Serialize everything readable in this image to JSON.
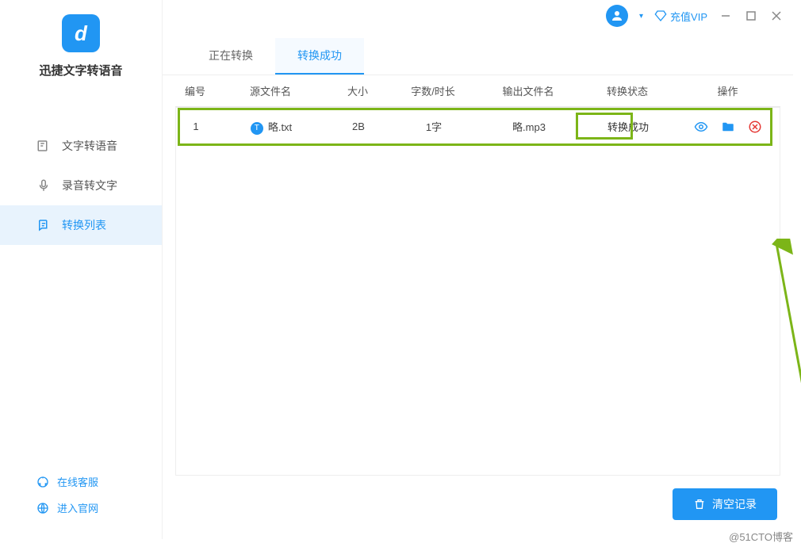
{
  "app": {
    "title": "迅捷文字转语音"
  },
  "sidebar": {
    "nav": [
      {
        "label": "文字转语音",
        "name": "nav-text-to-speech",
        "active": false
      },
      {
        "label": "录音转文字",
        "name": "nav-speech-to-text",
        "active": false
      },
      {
        "label": "转换列表",
        "name": "nav-convert-list",
        "active": true
      }
    ],
    "footer": {
      "support": "在线客服",
      "official": "进入官网"
    }
  },
  "header": {
    "vip_label": "充值VIP"
  },
  "tabs": [
    {
      "label": "正在转换",
      "active": false
    },
    {
      "label": "转换成功",
      "active": true
    }
  ],
  "table": {
    "headers": {
      "num": "编号",
      "source": "源文件名",
      "size": "大小",
      "count": "字数/时长",
      "output": "输出文件名",
      "status": "转换状态",
      "actions": "操作"
    },
    "rows": [
      {
        "num": "1",
        "source": "略.txt",
        "size": "2B",
        "count": "1字",
        "output": "略.mp3",
        "status": "转换成功"
      }
    ]
  },
  "buttons": {
    "clear": "清空记录"
  },
  "watermark": "@51CTO博客"
}
